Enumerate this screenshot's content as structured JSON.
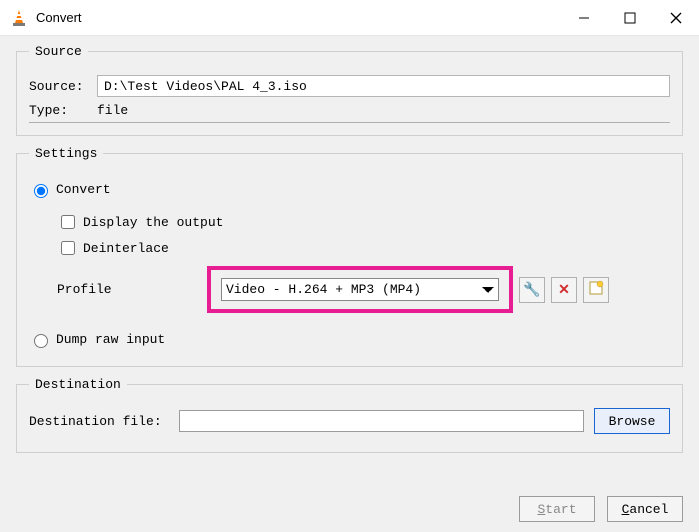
{
  "window": {
    "title": "Convert"
  },
  "source": {
    "legend": "Source",
    "source_label": "Source:",
    "source_value": "D:\\Test Videos\\PAL 4_3.iso",
    "type_label": "Type:",
    "type_value": "file"
  },
  "settings": {
    "legend": "Settings",
    "convert_label": "Convert",
    "display_output_label": "Display the output",
    "deinterlace_label": "Deinterlace",
    "profile_label": "Profile",
    "profile_value": "Video - H.264 + MP3 (MP4)",
    "dump_label": "Dump raw input"
  },
  "destination": {
    "legend": "Destination",
    "file_label": "Destination file:",
    "file_value": "",
    "browse_label": "Browse"
  },
  "footer": {
    "start_prefix": "S",
    "start_suffix": "tart",
    "cancel_prefix": "C",
    "cancel_suffix": "ancel"
  }
}
